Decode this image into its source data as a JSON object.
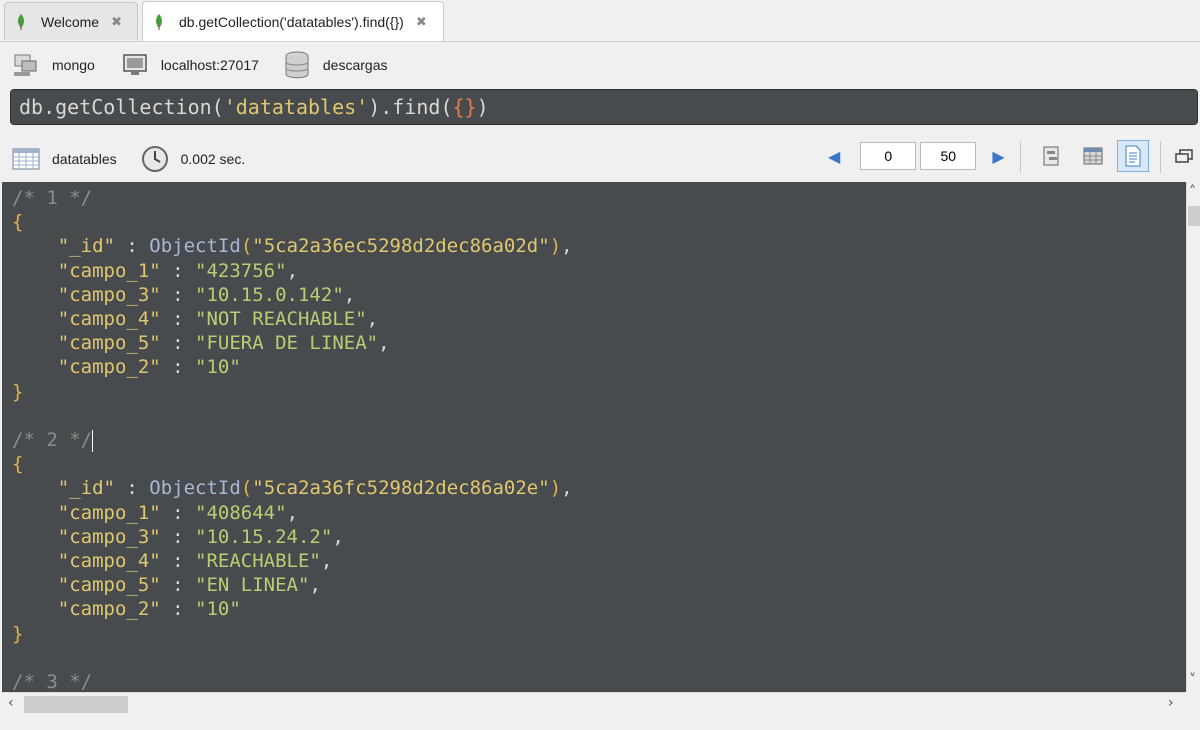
{
  "tabs": [
    {
      "label": "Welcome",
      "icon": "mongo-leaf-icon",
      "close": "✖"
    },
    {
      "label": "db.getCollection('datatables').find({})",
      "icon": "mongo-leaf-icon",
      "close": "✖"
    }
  ],
  "connection": {
    "shell": "mongo",
    "server": "localhost:27017",
    "database": "descargas"
  },
  "query": {
    "prefix": "db.getCollection(",
    "collection_arg": "'datatables'",
    "mid": ").find(",
    "braces": "{}",
    "suffix": ")"
  },
  "results_toolbar": {
    "collection": "datatables",
    "time": "0.002 sec.",
    "skip": "0",
    "limit": "50"
  },
  "documents": [
    {
      "comment": "/* 1 */",
      "id_value": "\"5ca2a36ec5298d2dec86a02d\"",
      "fields": [
        {
          "key": "\"campo_1\"",
          "value": "\"423756\""
        },
        {
          "key": "\"campo_3\"",
          "value": "\"10.15.0.142\""
        },
        {
          "key": "\"campo_4\"",
          "value": "\"NOT REACHABLE\""
        },
        {
          "key": "\"campo_5\"",
          "value": "\"FUERA DE LINEA\""
        },
        {
          "key": "\"campo_2\"",
          "value": "\"10\""
        }
      ]
    },
    {
      "comment": "/* 2 */",
      "id_value": "\"5ca2a36fc5298d2dec86a02e\"",
      "fields": [
        {
          "key": "\"campo_1\"",
          "value": "\"408644\""
        },
        {
          "key": "\"campo_3\"",
          "value": "\"10.15.24.2\""
        },
        {
          "key": "\"campo_4\"",
          "value": "\"REACHABLE\""
        },
        {
          "key": "\"campo_5\"",
          "value": "\"EN LINEA\""
        },
        {
          "key": "\"campo_2\"",
          "value": "\"10\""
        }
      ]
    },
    {
      "comment": "/* 3 */"
    }
  ],
  "syntax": {
    "id_key": "\"_id\"",
    "objectid": "ObjectId",
    "sep": " : ",
    "open": "{",
    "close": "}",
    "comma": ","
  },
  "colors": {
    "editor_bg": "#474b4d",
    "comment": "#8c8c8c",
    "key": "#e1c76f",
    "string": "#b6cf73",
    "function": "#a9b7d6"
  }
}
